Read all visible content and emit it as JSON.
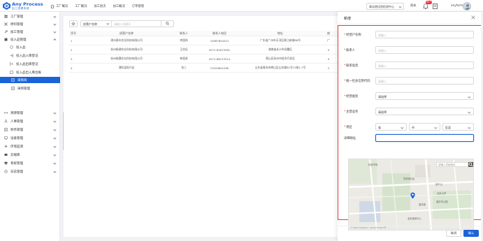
{
  "app": {
    "logo_title": "Any Process",
    "logo_subtitle": "加工查看系统",
    "brand_color": "#1a63d9"
  },
  "top_nav": {
    "items": [
      {
        "label": "工厂概况",
        "icon": "home-icon"
      },
      {
        "label": "工厂概况"
      },
      {
        "label": "加工批次"
      },
      {
        "label": "加工概况"
      },
      {
        "label": "订单管理"
      }
    ]
  },
  "header": {
    "org_select": "青岛港试验检测中心",
    "lang_label": "简体",
    "notification_count": "99+",
    "username": "anyfarm"
  },
  "sidebar": {
    "items": [
      {
        "label": "工厂管理",
        "icon": "factory-icon",
        "expand": "down"
      },
      {
        "label": "原料管理",
        "icon": "tools-icon",
        "expand": "down"
      },
      {
        "label": "加工管理",
        "icon": "wrench-icon",
        "expand": "down"
      },
      {
        "label": "投入品管理",
        "icon": "box-icon",
        "expand": "up"
      },
      {
        "label": "投入品",
        "icon": "circle-icon",
        "level": "sub"
      },
      {
        "label": "投入品入库登记",
        "icon": "inbound-icon",
        "level": "sub"
      },
      {
        "label": "投入品出库登记",
        "icon": "outbound-icon",
        "level": "sub"
      },
      {
        "label": "投入品出入库台账",
        "icon": "ledger-icon",
        "level": "sub"
      },
      {
        "label": "采购商",
        "icon": "buyer-icon",
        "level": "sub2",
        "active": true
      },
      {
        "label": "采购管理",
        "icon": "purchase-icon",
        "level": "sub2"
      },
      {
        "label": "溯源管理",
        "icon": "trace-icon",
        "expand": "down"
      },
      {
        "label": "人事管理",
        "icon": "person-icon",
        "expand": "down"
      },
      {
        "label": "财务管理",
        "icon": "finance-icon",
        "expand": "down"
      },
      {
        "label": "设备管理",
        "icon": "device-icon",
        "expand": "down"
      },
      {
        "label": "环境监测",
        "icon": "environment-icon",
        "expand": "down"
      },
      {
        "label": "云端库",
        "icon": "cloud-icon",
        "expand": "down"
      },
      {
        "label": "系统管理",
        "icon": "system-icon",
        "expand": "down"
      },
      {
        "label": "日志管理",
        "icon": "log-icon",
        "expand": "down"
      }
    ]
  },
  "list": {
    "filter_field": "经营户名称",
    "search_placeholder": "请输入关键词",
    "columns": [
      "序号",
      "经营户名称",
      "联系人",
      "联系人电话",
      "地址",
      "统"
    ],
    "rows": [
      [
        "1",
        "肃州源丰农业科技有限公司",
        "李国伟",
        "15987654321",
        "广东省广州市天河区珠江新城88号",
        "广"
      ],
      [
        "2",
        "杭州绿源农业科技有限公司",
        "王信远",
        "0571-61673281",
        "湖南省长沙市岳麓区",
        "9"
      ],
      [
        "3",
        "杭州绿晟农业科技有限公司",
        "林祖贤",
        "0571-86123314",
        "萧山区杭州市经济开发区",
        "9"
      ],
      [
        "4",
        "浦科县权兴店",
        "张三",
        "13209601260",
        "山东省青岛市崂山区山东路82号13栋1-7号",
        "2"
      ]
    ]
  },
  "drawer": {
    "title": "新增",
    "fields": [
      {
        "label": "经营户名称",
        "required": true,
        "placeholder": "请输入"
      },
      {
        "label": "联系人",
        "required": true,
        "placeholder": "请输入"
      },
      {
        "label": "联系电话",
        "required": true,
        "placeholder": "请输入"
      },
      {
        "label": "统一社会信用代码",
        "required": true,
        "placeholder": "请输入"
      },
      {
        "label": "经营类别",
        "required": true,
        "value": "请选择"
      },
      {
        "label": "主营业务",
        "required": true,
        "value": "请选择"
      }
    ],
    "region": {
      "label": "地区",
      "required": true,
      "province": "省",
      "city": "市",
      "district": "区县"
    },
    "address": {
      "label": "详细地址",
      "value": ""
    },
    "map": {
      "search_placeholder": "请输入详细地址",
      "labels": [
        "科技市场",
        "富锦街社区",
        "景平山",
        "北京大学",
        "重庆路",
        "重庆市公园",
        "全民健身中心"
      ],
      "copyright": "© 2024 AutoNavi - GS(2023)4677号"
    },
    "cancel_label": "取消",
    "ok_label": "确认"
  }
}
